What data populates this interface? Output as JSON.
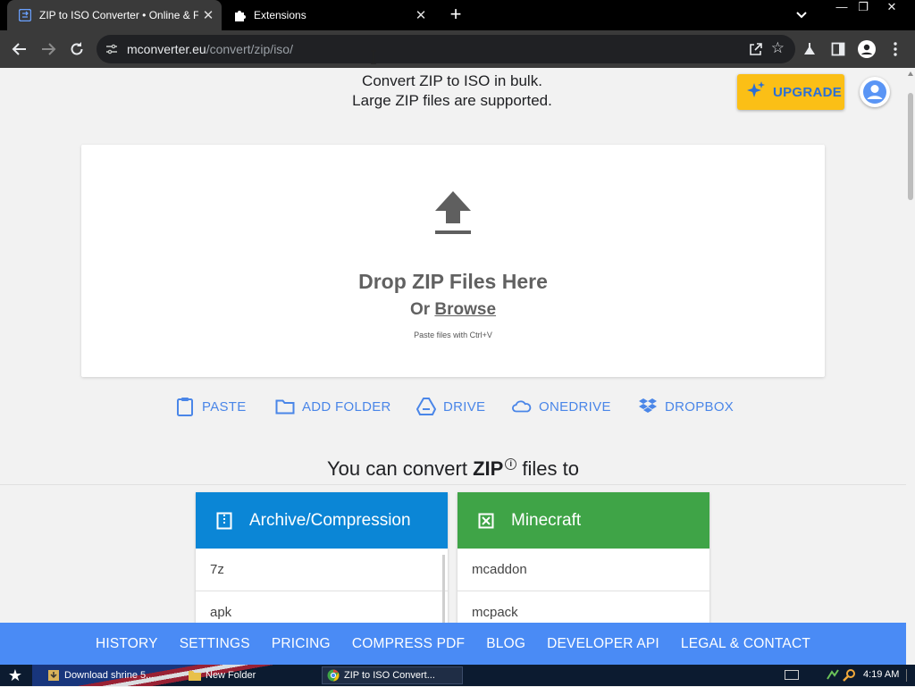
{
  "browser": {
    "tabs": [
      {
        "title": "ZIP to ISO Converter • Online & Fr",
        "active": true
      },
      {
        "title": "Extensions",
        "active": false
      }
    ],
    "new_tab": "+",
    "url_host": "mconverter.eu",
    "url_path": "/convert/zip/iso/",
    "controls": {
      "minimize": "—",
      "maximize": "❐",
      "close": "✕"
    }
  },
  "header": {
    "tagline_1": "Convert ZIP to ISO in bulk.",
    "tagline_2": "Large ZIP files are supported.",
    "upgrade_label": "UPGRADE"
  },
  "dropzone": {
    "heading": "Drop ZIP Files Here",
    "or_text": "Or",
    "browse": "Browse",
    "hint": "Paste files with Ctrl+V"
  },
  "sources": [
    {
      "label": "PASTE",
      "icon": "clipboard-icon"
    },
    {
      "label": "ADD FOLDER",
      "icon": "folder-icon"
    },
    {
      "label": "DRIVE",
      "icon": "google-drive-icon"
    },
    {
      "label": "ONEDRIVE",
      "icon": "onedrive-icon"
    },
    {
      "label": "DROPBOX",
      "icon": "dropbox-icon"
    }
  ],
  "convert_heading": {
    "prefix": "You can convert",
    "format": "ZIP",
    "info": "i",
    "suffix": "files to"
  },
  "categories": [
    {
      "title": "Archive/Compression",
      "color": "#0b86d6",
      "items": [
        "7z",
        "apk"
      ]
    },
    {
      "title": "Minecraft",
      "color": "#3fa447",
      "items": [
        "mcaddon",
        "mcpack"
      ]
    }
  ],
  "footer": {
    "links": [
      "HISTORY",
      "SETTINGS",
      "PRICING",
      "COMPRESS PDF",
      "BLOG",
      "DEVELOPER API",
      "LEGAL & CONTACT"
    ]
  },
  "taskbar": {
    "tasks": [
      "Download shrine 5...",
      "New Folder",
      "ZIP to ISO Convert..."
    ],
    "clock": "4:19 AM"
  },
  "colors": {
    "accent_blue": "#4a8bf5",
    "upgrade_yellow": "#fbbf16",
    "link_blue": "#4a86e8"
  }
}
